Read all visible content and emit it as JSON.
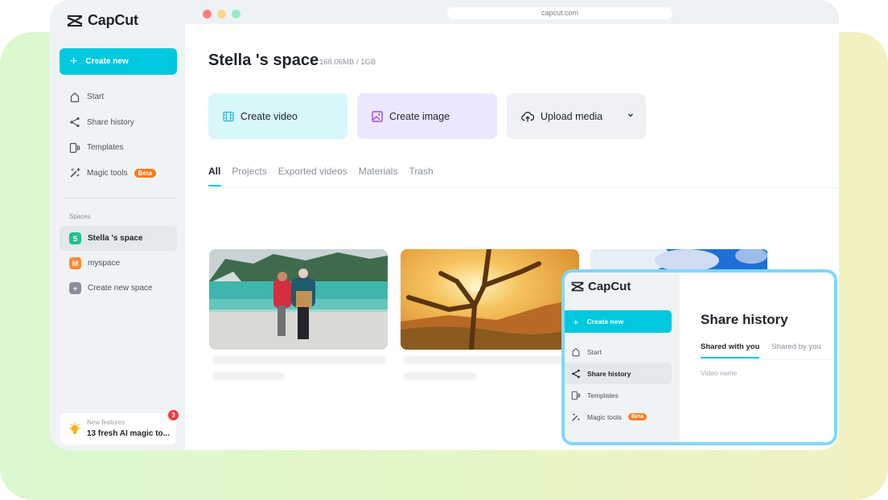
{
  "browser": {
    "url": "capcut.com"
  },
  "sidebar": {
    "brand": "CapCut",
    "create_label": "Create new",
    "nav": [
      {
        "label": "Start",
        "icon": "home-icon"
      },
      {
        "label": "Share history",
        "icon": "share-icon"
      },
      {
        "label": "Templates",
        "icon": "templates-icon"
      },
      {
        "label": "Magic tools",
        "icon": "magic-wand-icon",
        "badge": "Beta"
      }
    ],
    "spaces_label": "Spaces",
    "spaces": [
      {
        "initial": "S",
        "label": "Stella 's space",
        "color": "#1fc08e",
        "active": true
      },
      {
        "initial": "M",
        "label": "myspace",
        "color": "#ff8a33",
        "active": false
      },
      {
        "initial": "+",
        "label": "Create new space",
        "color": "#8a9099",
        "active": false
      }
    ],
    "features": {
      "label": "New features",
      "title": "13 fresh AI magic to...",
      "count": "3"
    }
  },
  "main": {
    "title": "Stella 's space",
    "storage": "168.06MB / 1GB",
    "actions": [
      {
        "label": "Create video",
        "icon": "film-icon"
      },
      {
        "label": "Create image",
        "icon": "image-icon"
      },
      {
        "label": "Upload media",
        "icon": "cloud-upload-icon"
      }
    ],
    "tabs": [
      "All",
      "Projects",
      "Exported videos",
      "Materials",
      "Trash"
    ],
    "active_tab": "All"
  },
  "popup": {
    "brand": "CapCut",
    "create_label": "Create new",
    "nav": [
      {
        "label": "Start"
      },
      {
        "label": "Share history",
        "active": true
      },
      {
        "label": "Templates"
      },
      {
        "label": "Magic tools",
        "badge": "Beta"
      }
    ],
    "title": "Share history",
    "tabs": [
      "Shared with you",
      "Shared by you"
    ],
    "column": "Video name"
  },
  "colors": {
    "accent": "#00c8de",
    "beta": "#ff7a1a",
    "popup_border": "#80d6fb"
  }
}
